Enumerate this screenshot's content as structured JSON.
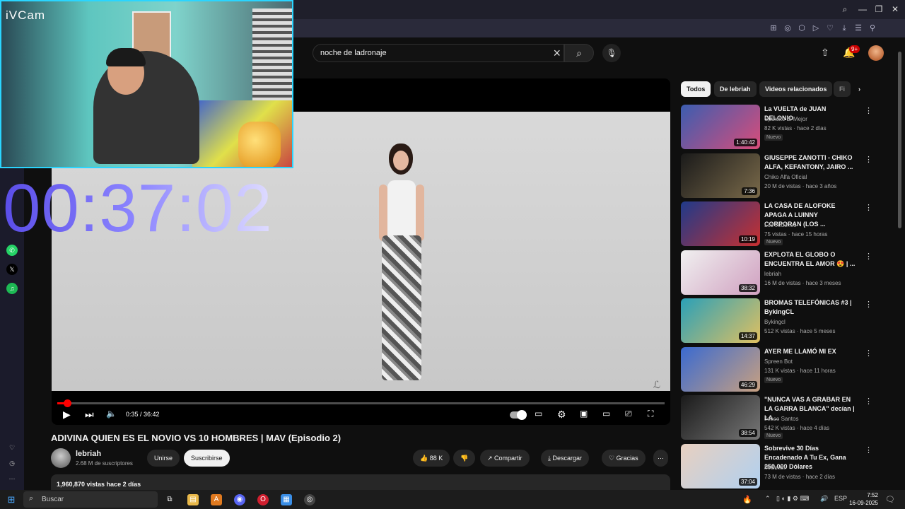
{
  "browser": {
    "window_controls": [
      "⌕",
      "—",
      "❐",
      "✕"
    ],
    "extensions": [
      "⊞",
      "◎",
      "⬡",
      "▷",
      "♡",
      "⤓",
      "☰",
      "⚲"
    ]
  },
  "search": {
    "query": "noche de ladronaje",
    "clear_icon": "×"
  },
  "header": {
    "notifications_badge": "9+"
  },
  "player": {
    "current_time": "0:35",
    "duration": "36:42",
    "time_display": "0:35 / 36:42",
    "progress": 0.016
  },
  "video": {
    "title": "ADIVINA QUIEN ES EL NOVIO VS 10 HOMBRES | MAV (Episodio 2)",
    "channel": "lebriah",
    "subscribers": "2.68 M de suscriptores",
    "join_label": "Unirse",
    "subscribe_label": "Suscribirse",
    "likes": "88 K",
    "share_label": "Compartir",
    "download_label": "Descargar",
    "thanks_label": "Gracias",
    "views_line": "1,960,870 vistas  hace 2 días"
  },
  "chips": [
    "Todos",
    "De lebriah",
    "Videos relacionados",
    "Fi"
  ],
  "recommendations": [
    {
      "title": "La VUELTA de JUAN DELONIO",
      "channel": "Spursito El Mejor",
      "meta": "82 K vistas · hace 2 días",
      "badge": "Nuevo",
      "duration": "1:40:42",
      "color1": "#3b5db0",
      "color2": "#d94d7a"
    },
    {
      "title": "GIUSEPPE ZANOTTI - CHIKO ALFA, KEFANTONY, JAIRO ...",
      "channel": "Chiko Alfa Oficial",
      "meta": "20 M de vistas · hace 3 años",
      "badge": "",
      "duration": "7:36",
      "color1": "#1a1a1a",
      "color2": "#7a6a4a"
    },
    {
      "title": "LA CASA DE ALOFOKE APAGA A LUINNY CORPORAN (LOS ...",
      "channel": "Los Jodones",
      "meta": "75 vistas · hace 15 horas",
      "badge": "Nuevo",
      "duration": "10:19",
      "color1": "#1f3a8a",
      "color2": "#c83030"
    },
    {
      "title": "EXPLOTA EL GLOBO O ENCUENTRA EL AMOR 😍 | ...",
      "channel": "lebriah",
      "meta": "16 M de vistas · hace 3 meses",
      "badge": "",
      "duration": "38:32",
      "color1": "#f0f0f0",
      "color2": "#d0a0c0"
    },
    {
      "title": "BROMAS TELEFÓNICAS #3 | BykingCL",
      "channel": "Bykingcl",
      "meta": "512 K vistas · hace 5 meses",
      "badge": "",
      "duration": "14:37",
      "color1": "#2aa0b8",
      "color2": "#e0c060"
    },
    {
      "title": "AYER ME LLAMÓ MI EX",
      "channel": "Spreen Bot",
      "meta": "131 K vistas · hace 11 horas",
      "badge": "Nuevo",
      "duration": "46:29",
      "color1": "#3a6ad0",
      "color2": "#c8a080"
    },
    {
      "title": "\"NUNCA VAS A GRABAR EN LA GARRA BLANCA\" decían | LA ...",
      "channel": "Joaco Santos",
      "meta": "542 K vistas · hace 4 días",
      "badge": "Nuevo",
      "duration": "38:54",
      "color1": "#1a1a1a",
      "color2": "#777777"
    },
    {
      "title": "Sobrevive 30 Días Encadenado A Tu Ex, Gana 250,000 Dólares",
      "channel": "MrBeast",
      "meta": "73 M de vistas · hace 2 días",
      "badge": "",
      "duration": "37:04",
      "color1": "#e8d0c0",
      "color2": "#b0d0f0"
    }
  ],
  "overlay": {
    "cam_label": "iVCam",
    "timer": "00:37:02"
  },
  "taskbar": {
    "search_placeholder": "Buscar",
    "lang": "ESP",
    "time": "7:52",
    "date": "16-09-2025"
  }
}
